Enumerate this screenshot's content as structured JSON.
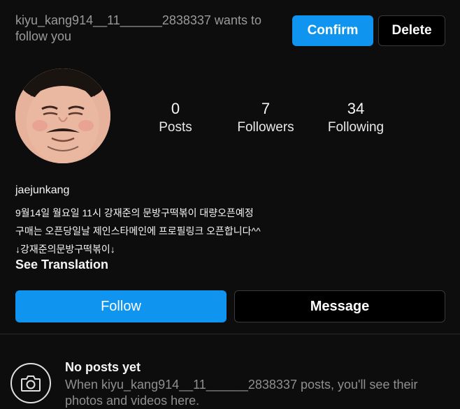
{
  "request": {
    "text": "kiyu_kang914__11______2838337 wants to follow you",
    "confirm_label": "Confirm",
    "delete_label": "Delete"
  },
  "profile": {
    "avatar_icon": "profile-photo",
    "stats": {
      "posts_count": "0",
      "posts_label": "Posts",
      "followers_count": "7",
      "followers_label": "Followers",
      "following_count": "34",
      "following_label": "Following"
    },
    "username": "jaejunkang",
    "bio_lines": [
      "9월14일 월요일 11시 강재준의 문방구떡볶이 대량오픈예정",
      "구매는 오픈당일날 제인스타메인에 프로필링크 오픈합니다^^",
      "↓강재준의문방구떡볶이↓"
    ],
    "see_translation": "See Translation"
  },
  "actions": {
    "follow_label": "Follow",
    "message_label": "Message"
  },
  "empty_state": {
    "icon": "camera-icon",
    "title": "No posts yet",
    "description": "When kiyu_kang914__11______2838337 posts, you'll see their photos and videos here."
  },
  "colors": {
    "accent": "#0f95f0",
    "background": "#0d0d0d"
  }
}
